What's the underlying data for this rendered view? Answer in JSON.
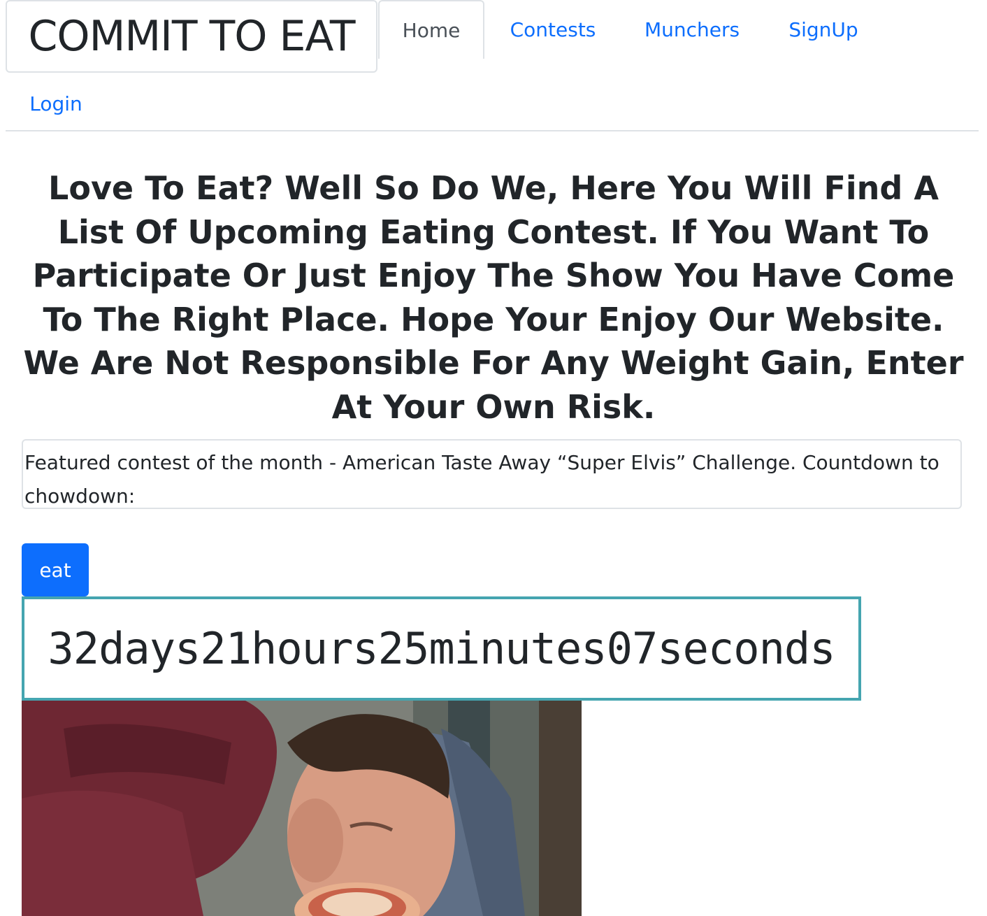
{
  "brand": {
    "title": "COMMIT TO EAT"
  },
  "nav": {
    "home": "Home",
    "contests": "Contests",
    "munchers": "Munchers",
    "signup": "SignUp",
    "login": "Login"
  },
  "intro": "Love To Eat? Well So Do We, Here You Will Find A List Of Upcoming Eating Contest. If You Want To Participate Or Just Enjoy The Show You Have Come To The Right Place. Hope Your Enjoy Our Website. We Are Not Responsible For Any Weight Gain, Enter At Your Own Risk.",
  "featured": {
    "text": "Featured contest of the month - American Taste Away “Super Elvis” Challenge. Countdown to chowdown:"
  },
  "button": {
    "label": "eat"
  },
  "countdown": {
    "text": "32days21hours25minutes07seconds"
  },
  "colors": {
    "link": "#0d6efd",
    "button_bg": "#0d6efd",
    "countdown_border": "#45a5b0",
    "divider": "#dee2e6"
  }
}
